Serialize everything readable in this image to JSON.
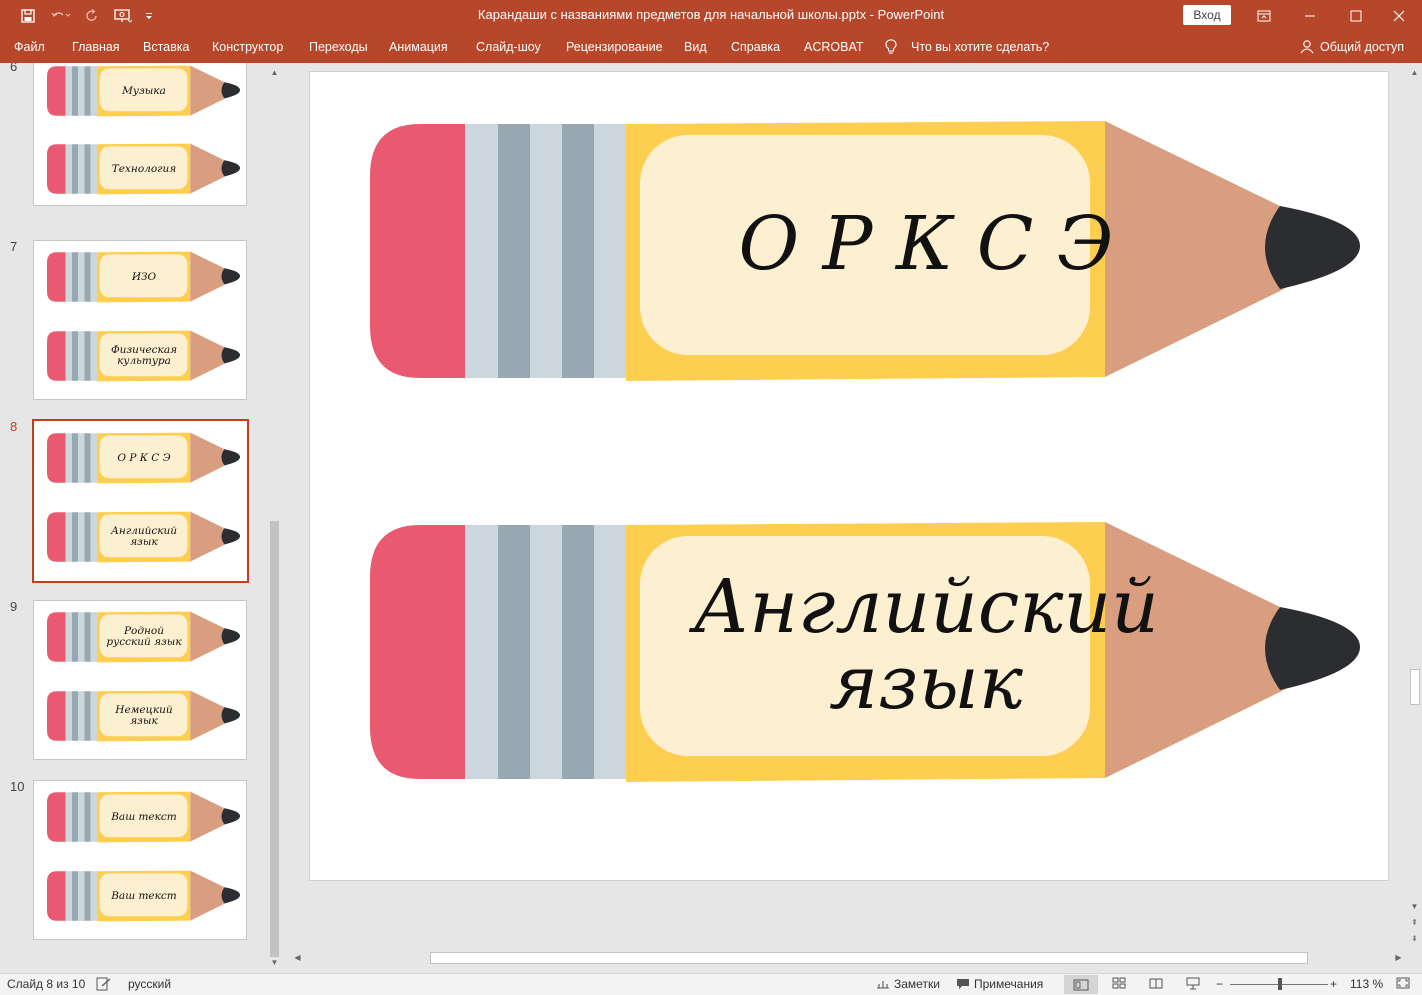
{
  "window": {
    "title": "Карандаши с названиями предметов для начальной школы.pptx  -  PowerPoint",
    "signin_label": "Вход"
  },
  "menu": {
    "items": [
      "Файл",
      "Главная",
      "Вставка",
      "Конструктор",
      "Переходы",
      "Анимация",
      "Слайд-шоу",
      "Рецензирование",
      "Вид",
      "Справка",
      "ACROBAT"
    ],
    "tell_me": "Что вы хотите сделать?",
    "share": "Общий доступ"
  },
  "thumbnails": [
    {
      "number": "6",
      "labels": [
        "Музыка",
        "Технология"
      ]
    },
    {
      "number": "7",
      "labels": [
        "ИЗО",
        "Физическая культура"
      ]
    },
    {
      "number": "8",
      "labels": [
        "О Р К С Э",
        "Английский язык"
      ]
    },
    {
      "number": "9",
      "labels": [
        "Родной русский язык",
        "Немецкий язык"
      ]
    },
    {
      "number": "10",
      "labels": [
        "Ваш текст",
        "Ваш текст"
      ]
    }
  ],
  "current_slide": {
    "pencil_1": "О Р К С Э",
    "pencil_2": "Английский язык"
  },
  "status": {
    "slide_info": "Слайд 8 из 10",
    "language": "русский",
    "notes": "Заметки",
    "comments": "Примечания",
    "zoom": "113 %"
  },
  "colors": {
    "ribbon": "#b7472a",
    "eraser": "#e95a70",
    "ferrule_light": "#cbd6dd",
    "ferrule_dark": "#98a8b2",
    "body": "#fdce4f",
    "label_bg": "#fdf0d0",
    "wood": "#d99e7f",
    "lead": "#2b2d30"
  }
}
